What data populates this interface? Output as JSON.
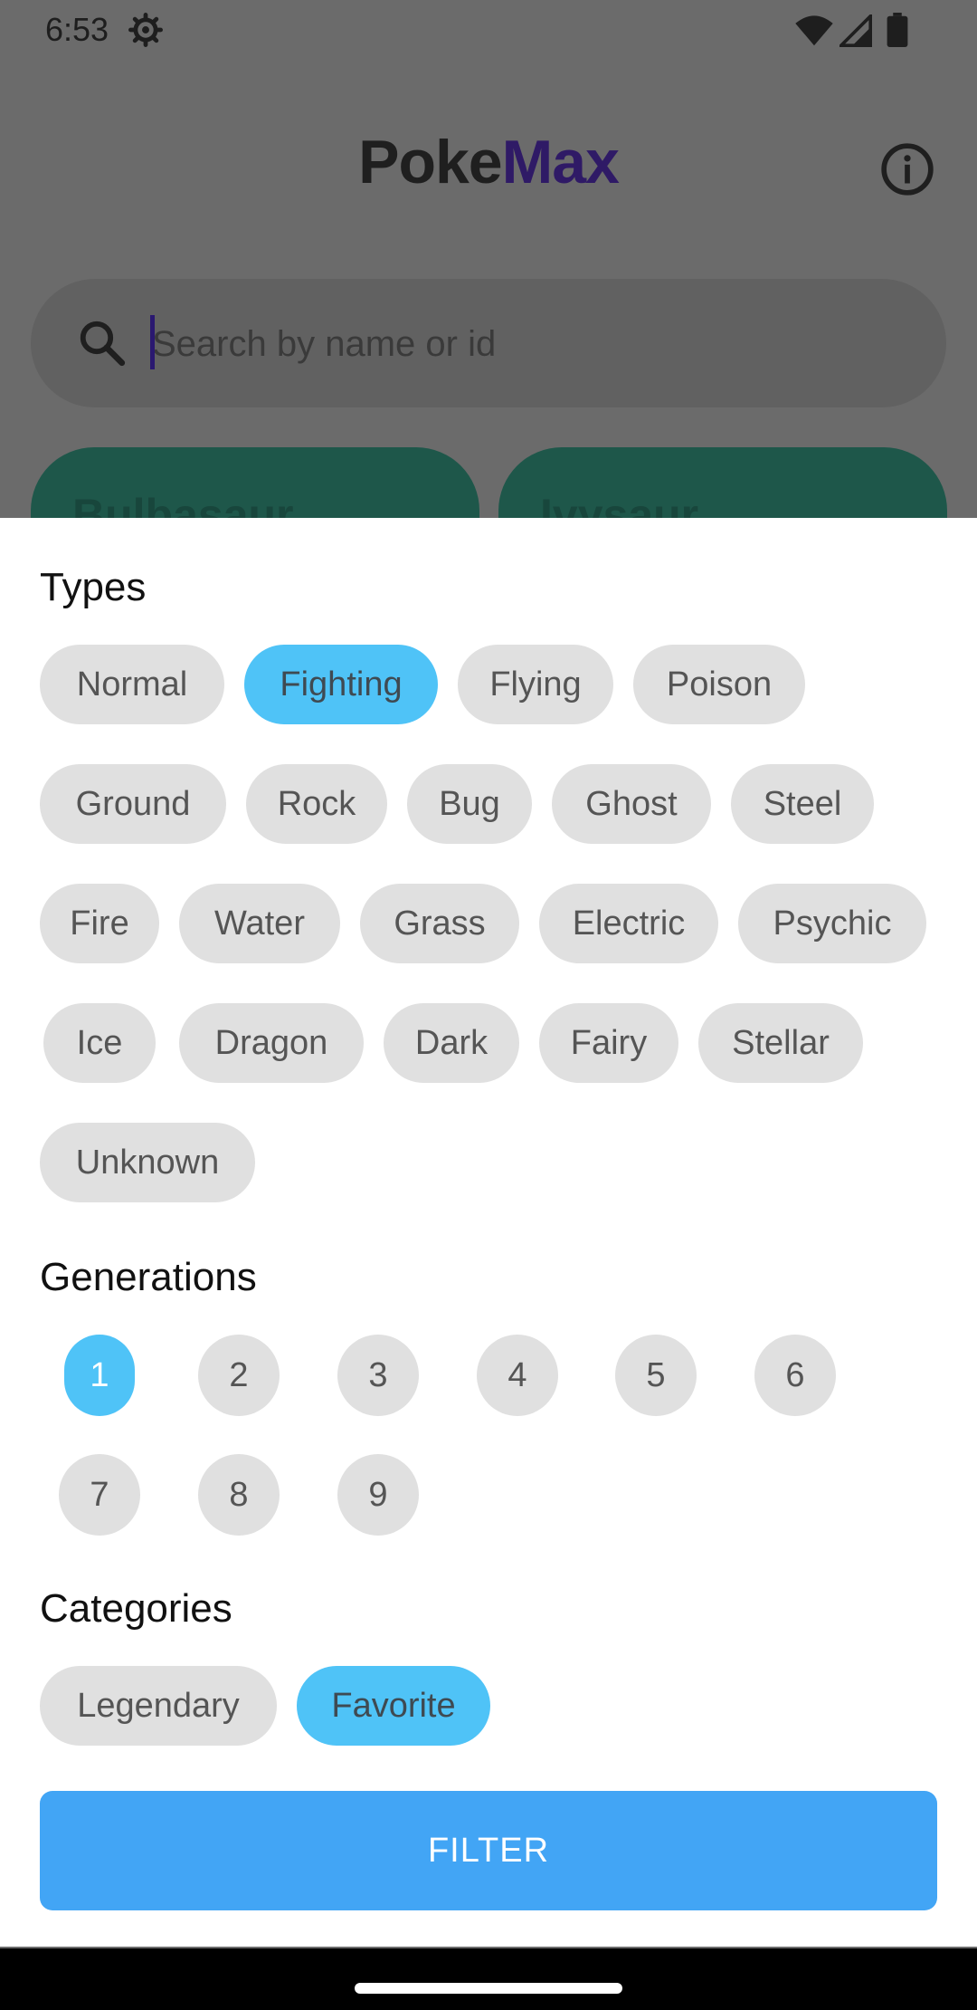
{
  "status_bar": {
    "time": "6:53"
  },
  "header": {
    "title_part1": "Poke",
    "title_part2": "Max"
  },
  "search": {
    "placeholder": "Search by name or id"
  },
  "cards": [
    {
      "name": "Bulbasaur",
      "color": "#1e574a"
    },
    {
      "name": "Ivysaur",
      "color": "#1e574a"
    }
  ],
  "filter_sheet": {
    "types_title": "Types",
    "types": [
      {
        "label": "Normal",
        "selected": false
      },
      {
        "label": "Fighting",
        "selected": true
      },
      {
        "label": "Flying",
        "selected": false
      },
      {
        "label": "Poison",
        "selected": false
      },
      {
        "label": "Ground",
        "selected": false
      },
      {
        "label": "Rock",
        "selected": false
      },
      {
        "label": "Bug",
        "selected": false
      },
      {
        "label": "Ghost",
        "selected": false
      },
      {
        "label": "Steel",
        "selected": false
      },
      {
        "label": "Fire",
        "selected": false
      },
      {
        "label": "Water",
        "selected": false
      },
      {
        "label": "Grass",
        "selected": false
      },
      {
        "label": "Electric",
        "selected": false
      },
      {
        "label": "Psychic",
        "selected": false
      },
      {
        "label": "Ice",
        "selected": false
      },
      {
        "label": "Dragon",
        "selected": false
      },
      {
        "label": "Dark",
        "selected": false
      },
      {
        "label": "Fairy",
        "selected": false
      },
      {
        "label": "Stellar",
        "selected": false
      },
      {
        "label": "Unknown",
        "selected": false
      }
    ],
    "generations_title": "Generations",
    "generations": [
      {
        "label": "1",
        "selected": true
      },
      {
        "label": "2",
        "selected": false
      },
      {
        "label": "3",
        "selected": false
      },
      {
        "label": "4",
        "selected": false
      },
      {
        "label": "5",
        "selected": false
      },
      {
        "label": "6",
        "selected": false
      },
      {
        "label": "7",
        "selected": false
      },
      {
        "label": "8",
        "selected": false
      },
      {
        "label": "9",
        "selected": false
      }
    ],
    "categories_title": "Categories",
    "categories": [
      {
        "label": "Legendary",
        "selected": false
      },
      {
        "label": "Favorite",
        "selected": true
      }
    ],
    "filter_button": "FILTER"
  },
  "colors": {
    "selected_chip": "#4fc3f7",
    "unselected_chip": "#e0e0e0",
    "filter_button": "#42a5f5",
    "title_accent": "#2f1a66"
  }
}
